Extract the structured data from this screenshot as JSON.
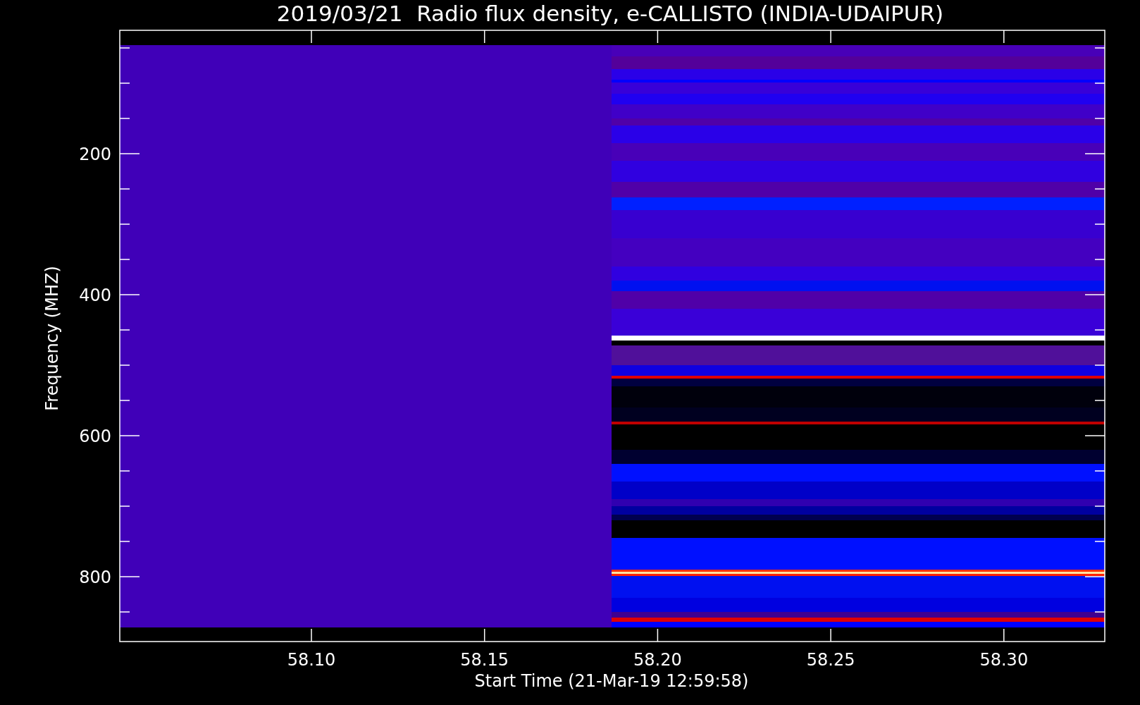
{
  "plot": {
    "title": "2019/03/21  Radio flux density, e-CALLISTO (INDIA-UDAIPUR)",
    "ylabel": "Frequency (MHZ)",
    "xlabel": "Start Time (21-Mar-19 12:59:58)",
    "yticks": [
      "200",
      "400",
      "600",
      "800"
    ],
    "xticks": [
      "58.10",
      "58.15",
      "58.20",
      "58.25",
      "58.30"
    ]
  }
}
